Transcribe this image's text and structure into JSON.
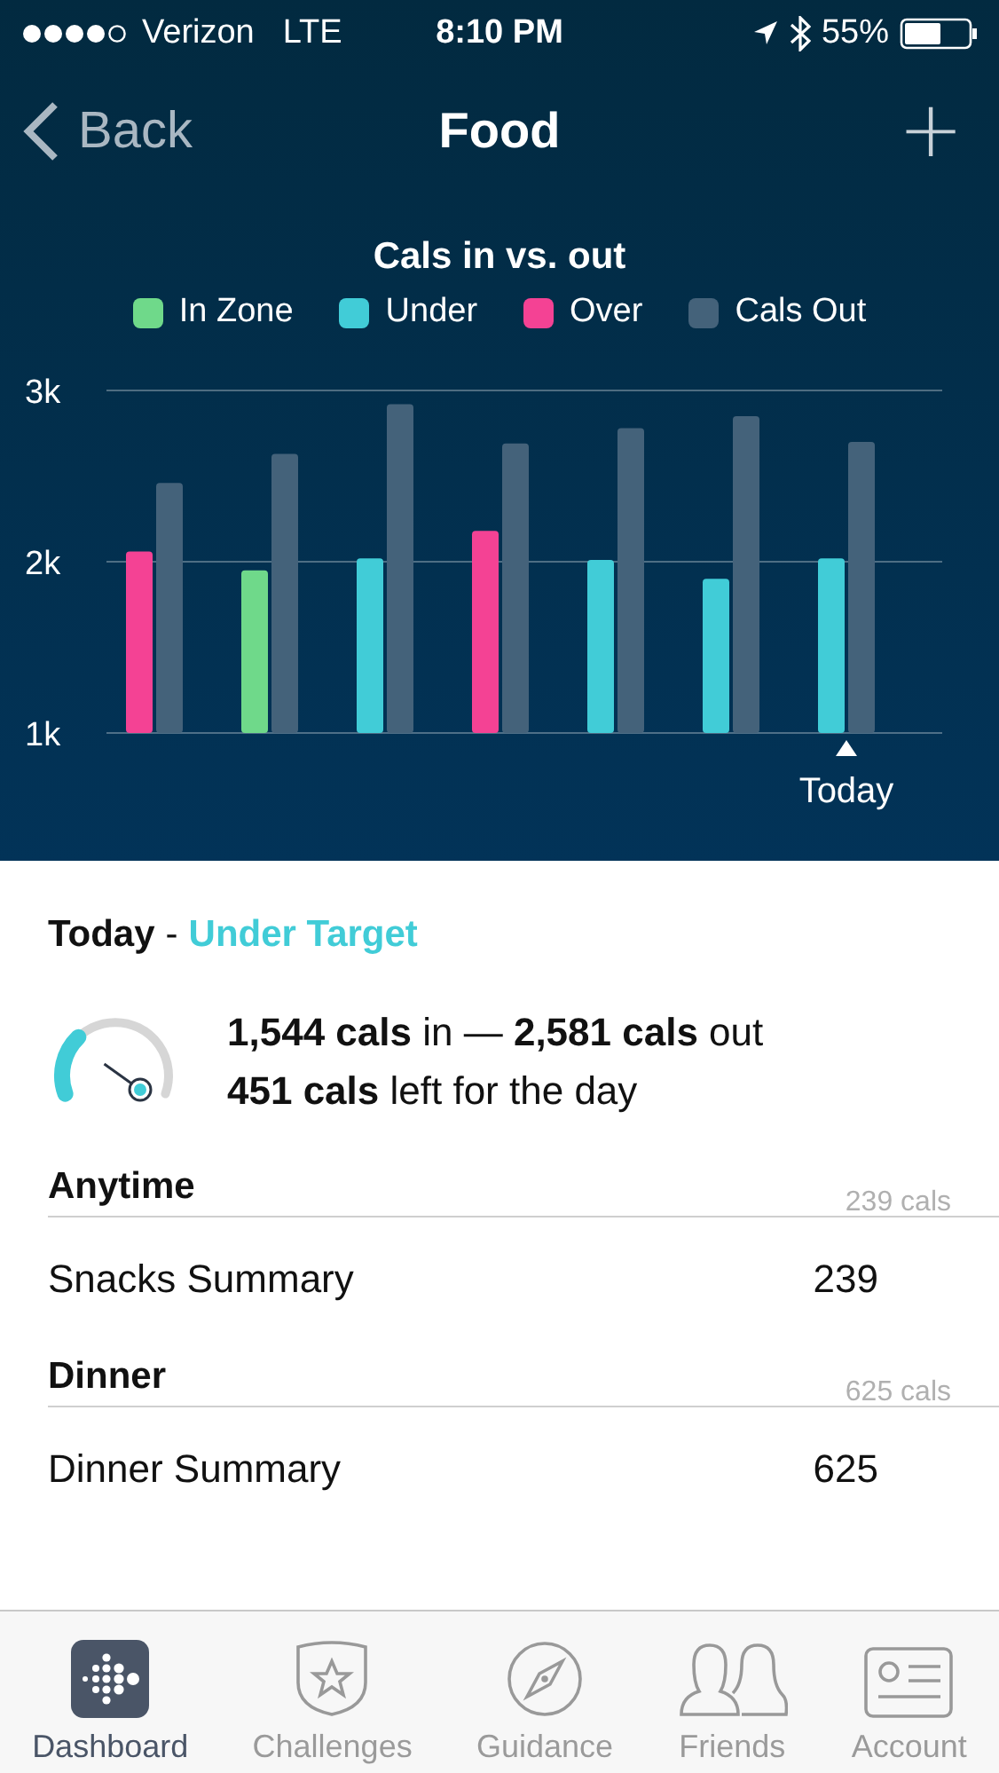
{
  "status_bar": {
    "carrier": "Verizon",
    "network": "LTE",
    "time": "8:10 PM",
    "battery": "55%"
  },
  "nav": {
    "back": "Back",
    "title": "Food",
    "add": "+"
  },
  "chart": {
    "legend": [
      {
        "label": "In Zone",
        "color": "#6fd98a"
      },
      {
        "label": "Under",
        "color": "#41ccd7"
      },
      {
        "label": "Over",
        "color": "#f44294"
      },
      {
        "label": "Cals Out",
        "color": "#44627a"
      }
    ],
    "marker": "Today",
    "chart_data": {
      "type": "bar",
      "title": "Cals in vs. out",
      "ylim": [
        1000,
        3000
      ],
      "yticks": [
        {
          "value": 1000,
          "label": "1k"
        },
        {
          "value": 2000,
          "label": "2k"
        },
        {
          "value": 3000,
          "label": "3k"
        }
      ],
      "series": [
        {
          "colors": [
            "#f44294",
            "#6fd98a",
            "#41ccd7",
            "#f44294",
            "#41ccd7",
            "#41ccd7",
            "#41ccd7"
          ],
          "values": [
            2060,
            1950,
            2020,
            2180,
            2010,
            1900,
            2020
          ]
        },
        {
          "color": "#44627a",
          "values": [
            2460,
            2630,
            2920,
            2690,
            2780,
            2850,
            2700
          ]
        }
      ]
    }
  },
  "summary": {
    "day": "Today",
    "separator": "-",
    "status": "Under Target",
    "line1": "**1,544 cals** in — **2,581 cals** out",
    "line2": "**451 cals** left for the day"
  },
  "meals": [
    {
      "title": "Anytime",
      "total": "239 cals",
      "rows": [
        {
          "name": "Snacks Summary",
          "value": "239"
        }
      ]
    },
    {
      "title": "Dinner",
      "total": "625 cals",
      "rows": [
        {
          "name": "Dinner Summary",
          "value": "625"
        }
      ]
    }
  ],
  "tabs": [
    {
      "label": "Dashboard",
      "selected": true
    },
    {
      "label": "Challenges",
      "selected": false
    },
    {
      "label": "Guidance",
      "selected": false
    },
    {
      "label": "Friends",
      "selected": false
    },
    {
      "label": "Account",
      "selected": false
    }
  ]
}
